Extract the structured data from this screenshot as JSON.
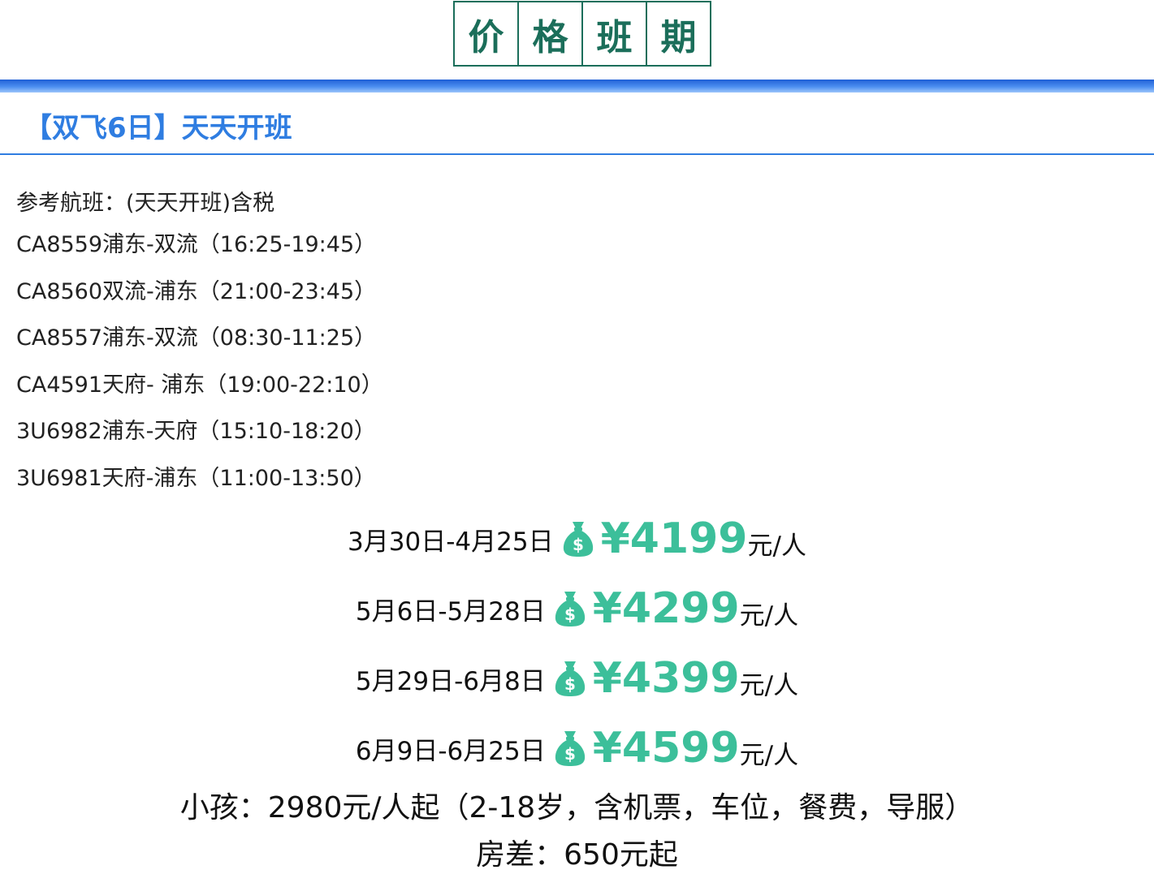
{
  "header": {
    "title_chars": [
      "价",
      "格",
      "班",
      "期"
    ]
  },
  "section": {
    "heading": "【双飞6日】天天开班"
  },
  "flights": {
    "reference": "参考航班：(天天开班)含税",
    "items": [
      "CA8559浦东-双流（16:25-19:45）",
      "CA8560双流-浦东（21:00-23:45）",
      "CA8557浦东-双流（08:30-11:25）",
      "CA4591天府- 浦东（19:00-22:10）",
      "3U6982浦东-天府（15:10-18:20）",
      "3U6981天府-浦东（11:00-13:50）"
    ]
  },
  "prices": [
    {
      "dates": "3月30日-4月25日",
      "amount": "¥4199",
      "unit": "元/人"
    },
    {
      "dates": "5月6日-5月28日",
      "amount": "¥4299",
      "unit": "元/人"
    },
    {
      "dates": "5月29日-6月8日",
      "amount": "¥4399",
      "unit": "元/人"
    },
    {
      "dates": "6月9日-6月25日",
      "amount": "¥4599",
      "unit": "元/人"
    }
  ],
  "notes": {
    "child": "小孩：2980元/人起（2-18岁，含机票，车位，餐费，导服）",
    "room": "房差：650元起"
  },
  "colors": {
    "title_green": "#1b6e5a",
    "heading_blue": "#2f7de1",
    "price_green": "#3cbf9a"
  },
  "icons": {
    "price_icon": "money-bag-icon"
  }
}
